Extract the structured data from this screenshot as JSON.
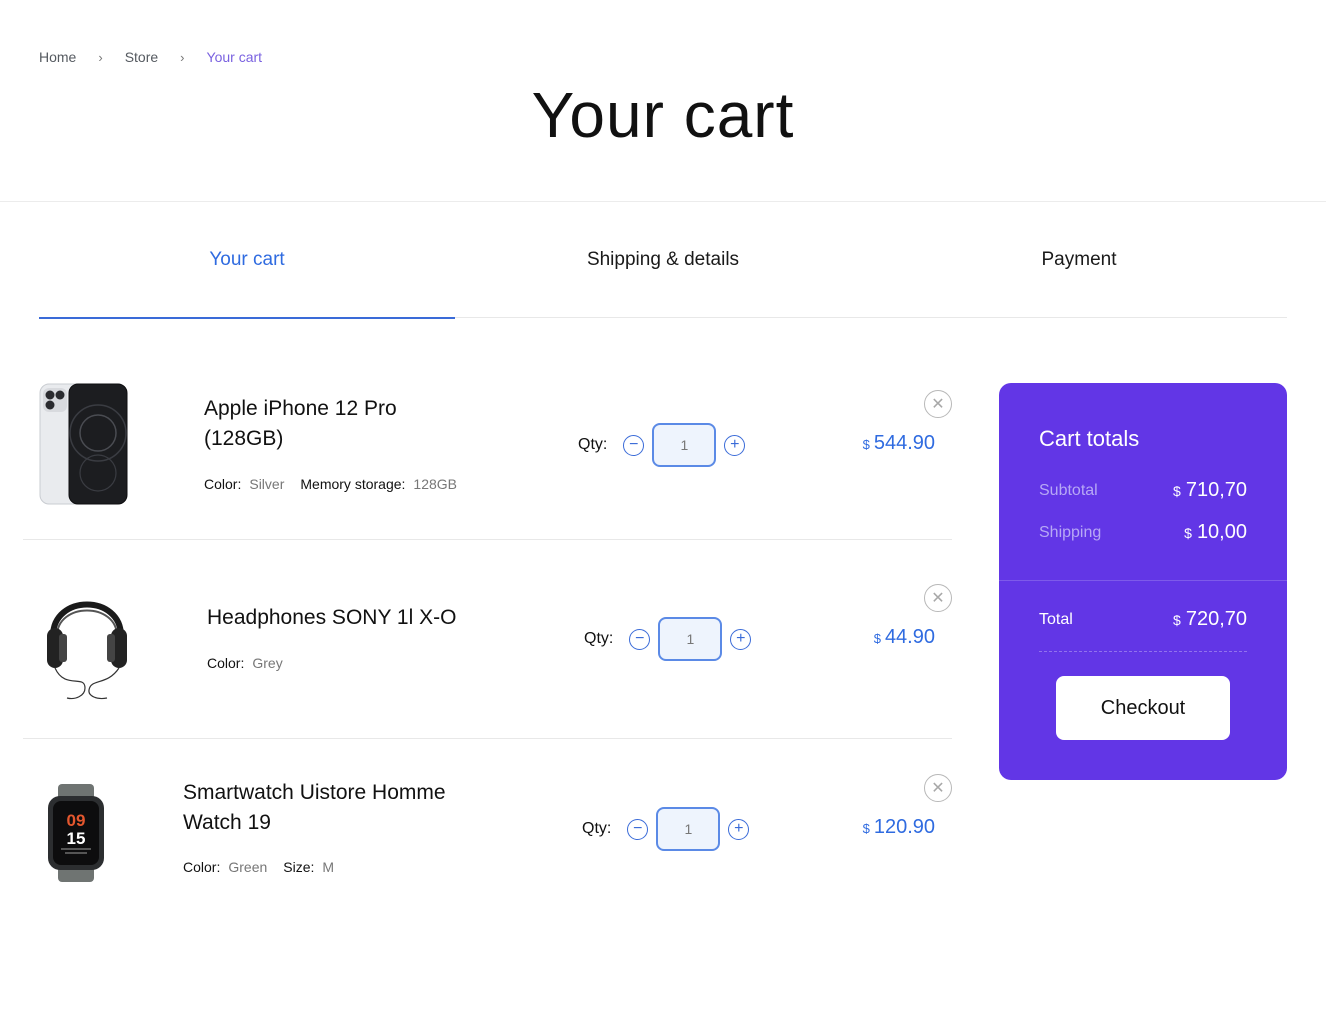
{
  "breadcrumb": {
    "items": [
      "Home",
      "Store",
      "Your cart"
    ]
  },
  "page_title": "Your cart",
  "steps": [
    "Your cart",
    "Shipping & details",
    "Payment"
  ],
  "qty_label": "Qty:",
  "currency": "$",
  "items": [
    {
      "name_line1": "Apple iPhone 12 Pro",
      "name_line2": "(128GB)",
      "attrs": [
        {
          "key": "Color:",
          "value": "Silver"
        },
        {
          "key": "Memory storage:",
          "value": "128GB"
        }
      ],
      "qty": "1",
      "price": "544.90",
      "image": "iphone-image"
    },
    {
      "name_line1": "Headphones SONY 1l X-O",
      "attrs": [
        {
          "key": "Color:",
          "value": "Grey"
        }
      ],
      "qty": "1",
      "price": "44.90",
      "image": "headphones-image"
    },
    {
      "name_line1": "Smartwatch Uistore Homme",
      "name_line2": "Watch 19",
      "attrs": [
        {
          "key": "Color:",
          "value": "Green"
        },
        {
          "key": "Size:",
          "value": "M"
        }
      ],
      "qty": "1",
      "price": "120.90",
      "image": "smartwatch-image",
      "watch_hours": "09",
      "watch_minutes": "15"
    }
  ],
  "totals": {
    "title": "Cart totals",
    "subtotal_label": "Subtotal",
    "subtotal_value": "710,70",
    "shipping_label": "Shipping",
    "shipping_value": "10,00",
    "total_label": "Total",
    "total_value": "720,70",
    "checkout_label": "Checkout"
  },
  "colors": {
    "accent": "#2f6be0",
    "panel": "#6236e6",
    "breadcrumb_current": "#7a62e0"
  }
}
